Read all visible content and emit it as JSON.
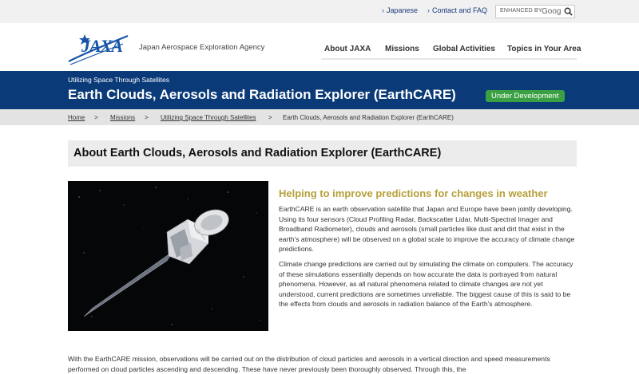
{
  "util": {
    "japanese": "Japanese",
    "contact": "Contact and FAQ",
    "search_label": "ENHANCED BY",
    "search_brand": "Goog"
  },
  "header": {
    "agency": "Japan Aerospace Exploration Agency",
    "nav": [
      "About JAXA",
      "Missions",
      "Global Activities",
      "Topics in Your Area"
    ]
  },
  "banner": {
    "subtitle": "Utilizing Space Through Satellites",
    "title": "Earth Clouds, Aerosols and Radiation Explorer (EarthCARE)",
    "status": "Under Development"
  },
  "breadcrumb": {
    "home": "Home",
    "missions": "Missions",
    "category": "Utilizing Space Through Satellites",
    "current": "Earth Clouds, Aerosols and Radiation Explorer (EarthCARE)",
    "sep": ">"
  },
  "section": {
    "heading": "About Earth Clouds, Aerosols and Radiation Explorer (EarthCARE)",
    "lead": "Helping to improve predictions for changes in weather",
    "para1": "EarthCARE is an earth observation satellite that Japan and Europe have been jointly developing. Using its four sensors (Cloud Profiling Radar, Backscatter Lidar, Multi-Spectral Imager and Broadband Radiometer), clouds and aerosols (small particles like dust and dirt that exist in the earth's atmosphere) will be observed on a global scale to improve the accuracy of climate change predictions.",
    "para2": "Climate change predictions are carried out by simulating the climate on computers. The accuracy of these simulations essentially depends on how accurate the data is portrayed from natural phenomena. However, as all natural phenomena related to climate changes are not yet understood, current predictions are sometimes unreliable. The biggest cause of this is said to be the effects from clouds and aerosols in radiation balance of the Earth's atmosphere.",
    "bottom": "With the EarthCARE mission, observations will be carried out on the distribution of cloud particles and aerosols in a vertical direction and speed measurements performed on cloud particles ascending and descending. These have never previously been thoroughly observed. Through this, the"
  }
}
